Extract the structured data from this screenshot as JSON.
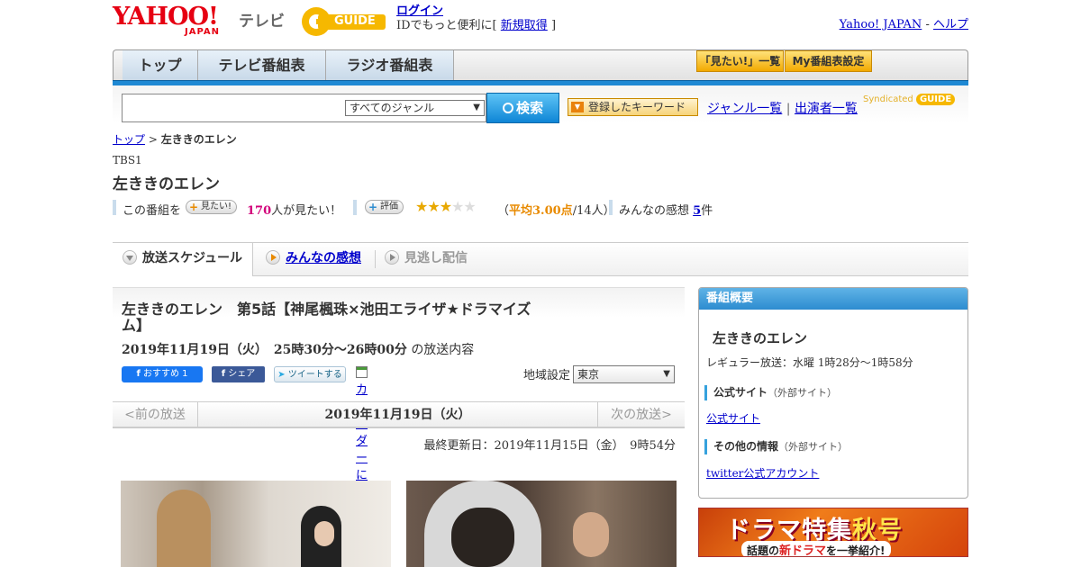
{
  "header": {
    "yahoo_logo": "YAHOO!",
    "yahoo_logo_sub": "JAPAN",
    "tv_label": "テレビ",
    "gguide_logo": "GUIDE",
    "login": "ログイン",
    "id_prefix": "IDでもっと便利に[",
    "signup": "新規取得",
    "id_suffix": "]",
    "yahoo_japan_link": "Yahoo! JAPAN",
    "separator": "-",
    "help_link": "ヘルプ"
  },
  "nav": {
    "tabs": [
      {
        "label": "トップ"
      },
      {
        "label": "テレビ番組表"
      },
      {
        "label": "ラジオ番組表"
      }
    ],
    "want_list": "「見たい!」一覧",
    "my_schedule": "My番組表設定"
  },
  "search": {
    "placeholder": "",
    "genre_selected": "すべてのジャンル",
    "button": "検索",
    "keyword_button": "登録したキーワード",
    "genre_list": "ジャンル一覧",
    "divider": "|",
    "performer_list": "出演者一覧",
    "syndicated": "Syndicated"
  },
  "breadcrumb": {
    "top": "トップ",
    "sep": ">",
    "current": "左ききのエレン"
  },
  "program": {
    "channel": "TBS1",
    "title": "左ききのエレン",
    "this_program": "この番組を",
    "want_button": "見たい!",
    "want_count": "170",
    "want_suffix": "人が見たい！",
    "rate_button": "評価",
    "rating_stars": 3,
    "rating_open": "（",
    "rating_text": "平均3.00点",
    "rating_count": "/14人）",
    "impressions_label": "みんなの感想",
    "impressions_count": "5",
    "impressions_suffix": "件"
  },
  "content_tabs": [
    {
      "label": "放送スケジュール"
    },
    {
      "label": "みんなの感想"
    },
    {
      "label": "見逃し配信"
    }
  ],
  "episode": {
    "title": "左ききのエレン　第5話【神尾楓珠×池田エライザ★ドラマイズム】",
    "date": "2019年11月19日（火）　25時30分～26時00分",
    "date_suffix": "の放送内容",
    "fb_recommend": "おすすめ 1",
    "fb_share": "シェア",
    "tweet": "ツイートする",
    "calendar": "カレンダーに登録",
    "region_label": "地域設定",
    "region_value": "東京"
  },
  "pager": {
    "prev": "<前の放送",
    "current": "2019年11月19日（火）",
    "next": "次の放送>"
  },
  "updated": "最終更新日：2019年11月15日（金）　9時54分",
  "sidebar": {
    "header": "番組概要",
    "title": "左ききのエレン",
    "regular": "レギュラー放送：水曜 1時28分～1時58分",
    "official_heading": "公式サイト",
    "external": "（外部サイト）",
    "official_link": "公式サイト",
    "other_heading": "その他の情報",
    "twitter_link": "twitter公式アカウント"
  },
  "banner": {
    "line1_a": "ドラマ特集",
    "line1_b": "秋号",
    "line2_a": "話題の",
    "line2_b": "新ドラマ",
    "line2_c": "を一挙紹介!"
  },
  "colors": {
    "accent_blue": "#1e88d3",
    "link": "#0000cc",
    "rating_orange": "#e88a00",
    "want_count": "#d2007a"
  }
}
